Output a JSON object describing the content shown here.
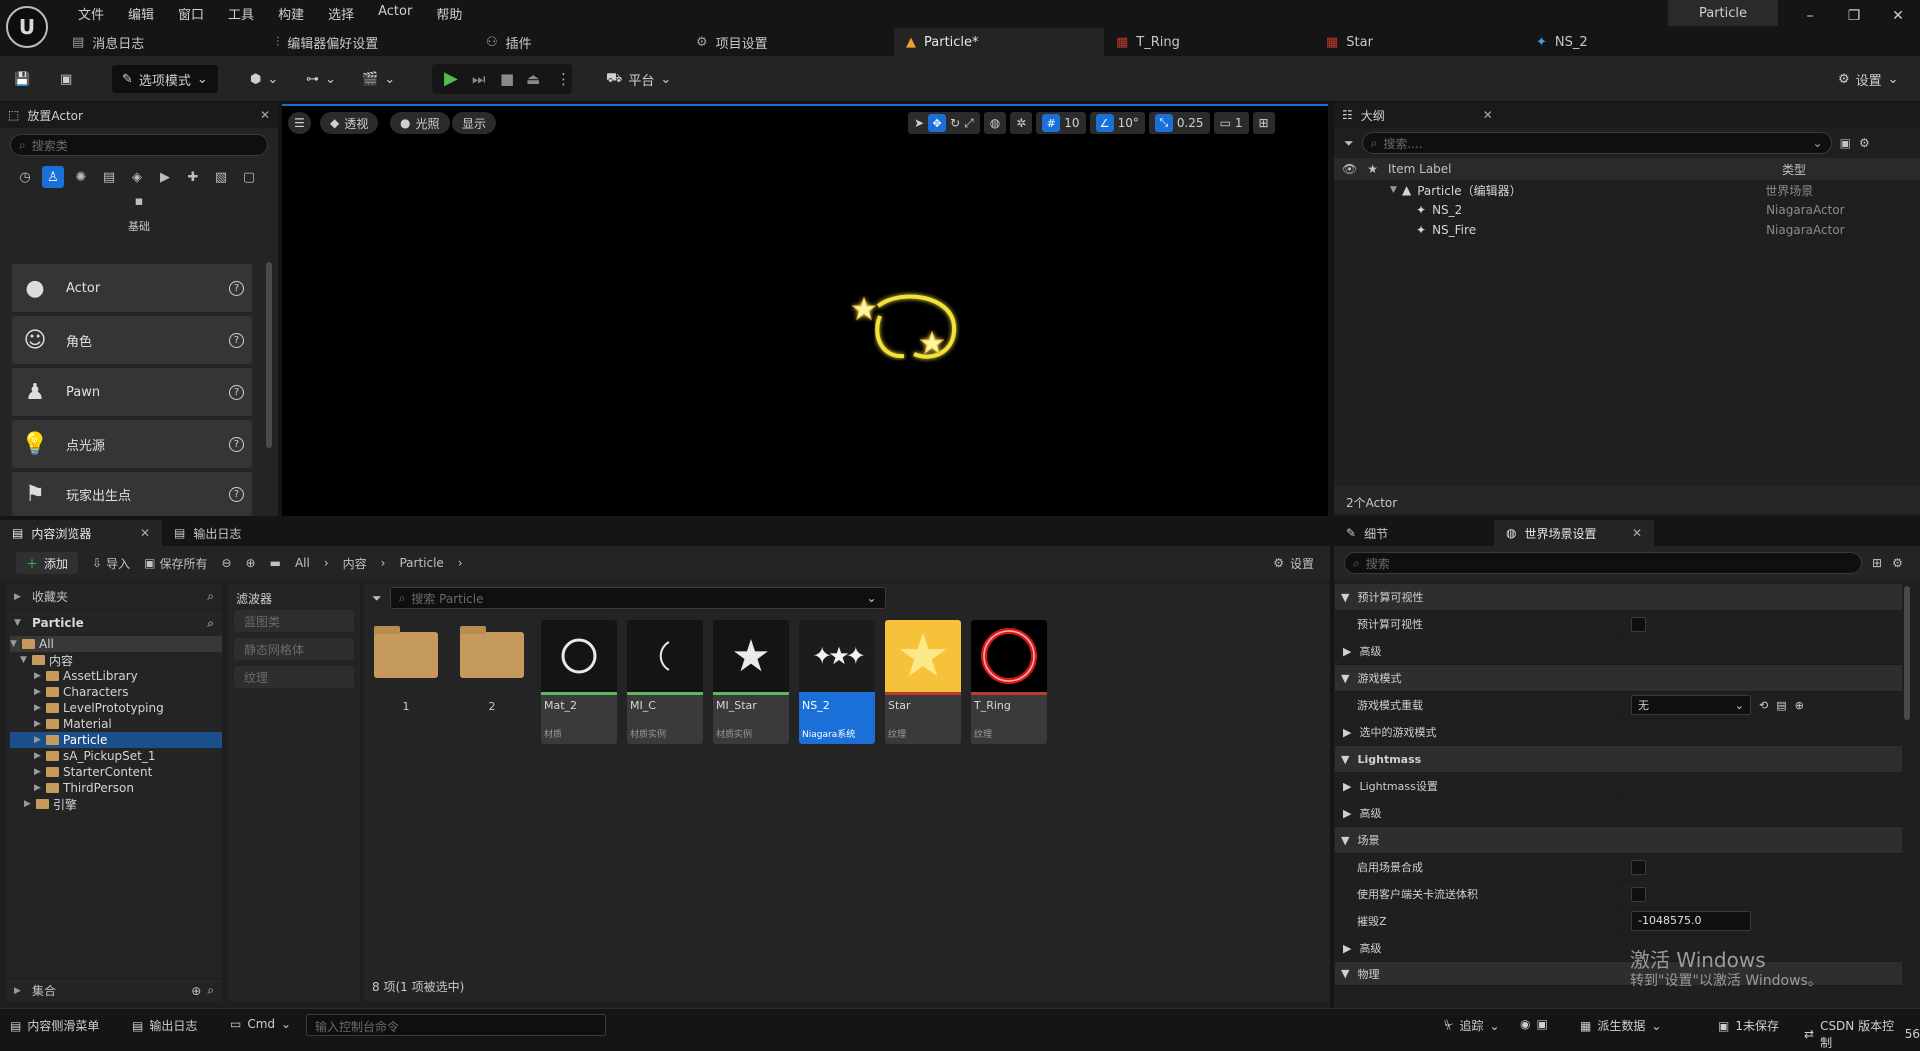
{
  "menubar": {
    "logo": "U",
    "items": [
      "文件",
      "编辑",
      "窗口",
      "工具",
      "构建",
      "选择",
      "Actor",
      "帮助"
    ],
    "project_title": "Particle"
  },
  "tabs": [
    {
      "label": "消息日志",
      "icon": "message-log-icon"
    },
    {
      "label": "编辑器偏好设置",
      "icon": "sliders-icon"
    },
    {
      "label": "插件",
      "icon": "plugin-icon"
    },
    {
      "label": "项目设置",
      "icon": "gear-icon"
    },
    {
      "label": "Particle*",
      "icon": "level-icon",
      "active": true
    },
    {
      "label": "T_Ring",
      "icon": "texture-icon"
    },
    {
      "label": "Star",
      "icon": "texture-icon"
    },
    {
      "label": "NS_2",
      "icon": "niagara-icon"
    }
  ],
  "toolbar": {
    "mode_label": "选项模式",
    "platform_label": "平台",
    "settings_label": "设置"
  },
  "place_actors": {
    "title": "放置Actor",
    "search_placeholder": "搜索类",
    "category_label": "基础",
    "items": [
      {
        "label": "Actor",
        "icon": "sphere-icon"
      },
      {
        "label": "角色",
        "icon": "character-icon"
      },
      {
        "label": "Pawn",
        "icon": "pawn-icon"
      },
      {
        "label": "点光源",
        "icon": "lightbulb-icon"
      },
      {
        "label": "玩家出生点",
        "icon": "flag-icon"
      }
    ]
  },
  "viewport": {
    "perspective": "透视",
    "lighting": "光照",
    "show": "显示",
    "grid_snap": "10",
    "rotation_snap": "10°",
    "scale_snap": "0.25",
    "camera_speed": "1"
  },
  "outliner": {
    "title": "大纲",
    "search_placeholder": "搜索....",
    "col_label": "Item Label",
    "col_type": "类型",
    "rows": [
      {
        "label": "Particle（编辑器）",
        "type": "世界场景"
      },
      {
        "label": "NS_2",
        "type": "NiagaraActor"
      },
      {
        "label": "NS_Fire",
        "type": "NiagaraActor"
      }
    ],
    "count": "2个Actor"
  },
  "content_browser": {
    "tab_label": "内容浏览器",
    "output_tab": "输出日志",
    "add_label": "添加",
    "import_label": "导入",
    "save_all_label": "保存所有",
    "breadcrumb": [
      "All",
      "内容",
      "Particle"
    ],
    "settings_label": "设置",
    "favorites_label": "收藏夹",
    "root_label": "Particle",
    "tree": {
      "all": "All",
      "content": "内容",
      "folders": [
        "AssetLibrary",
        "Characters",
        "LevelPrototyping",
        "Material",
        "Particle",
        "sA_PickupSet_1",
        "StarterContent",
        "ThirdPerson"
      ],
      "engine": "引擎"
    },
    "collections_label": "集合",
    "filters_label": "滤波器",
    "filters": [
      "蓝图类",
      "静态网格体",
      "纹理"
    ],
    "search_placeholder": "搜索 Particle",
    "folder_items": [
      "1",
      "2"
    ],
    "assets": [
      {
        "name": "Mat_2",
        "type": "材质",
        "bar": "#5fb85f"
      },
      {
        "name": "MI_C",
        "type": "材质实例",
        "bar": "#5fb85f"
      },
      {
        "name": "MI_Star",
        "type": "材质实例",
        "bar": "#5fb85f"
      },
      {
        "name": "NS_2",
        "type": "Niagara系统",
        "bar": "#1a6fd8"
      },
      {
        "name": "Star",
        "type": "纹理",
        "bar": "#c0392b"
      },
      {
        "name": "T_Ring",
        "type": "纹理",
        "bar": "#c0392b"
      }
    ],
    "item_count": "8 项(1 项被选中)"
  },
  "details": {
    "tab_label": "细节",
    "world_tab": "世界场景设置",
    "search_placeholder": "搜索",
    "rows": [
      {
        "label": "预计算可视性",
        "section": true
      },
      {
        "label": "预计算可视性",
        "checkbox": true
      },
      {
        "label": "高级",
        "sub": true
      },
      {
        "label": "游戏模式",
        "section": true
      },
      {
        "label": "游戏模式重载",
        "dropdown": "无"
      },
      {
        "label": "选中的游戏模式",
        "sub": true
      },
      {
        "label": "Lightmass",
        "section": true
      },
      {
        "label": "Lightmass设置",
        "sub": true
      },
      {
        "label": "高级",
        "sub": true
      },
      {
        "label": "场景",
        "section": true
      },
      {
        "label": "启用场景合成",
        "checkbox": true
      },
      {
        "label": "使用客户端关卡流送体积",
        "checkbox": true
      },
      {
        "label": "摧毁Z",
        "input": "-1048575.0"
      },
      {
        "label": "高级",
        "sub": true
      },
      {
        "label": "物理",
        "section": true
      }
    ],
    "watermark_line1": "激活 Windows",
    "watermark_line2": "转到\"设置\"以激活 Windows。"
  },
  "statusbar": {
    "drawer": "内容侧滑菜单",
    "output": "输出日志",
    "cmd": "Cmd",
    "console_placeholder": "输入控制台命令",
    "trace": "追踪",
    "derived_data": "派生数据",
    "unsaved": "1未保存",
    "source_control": "CSDN 版本控制",
    "extra": "56"
  }
}
